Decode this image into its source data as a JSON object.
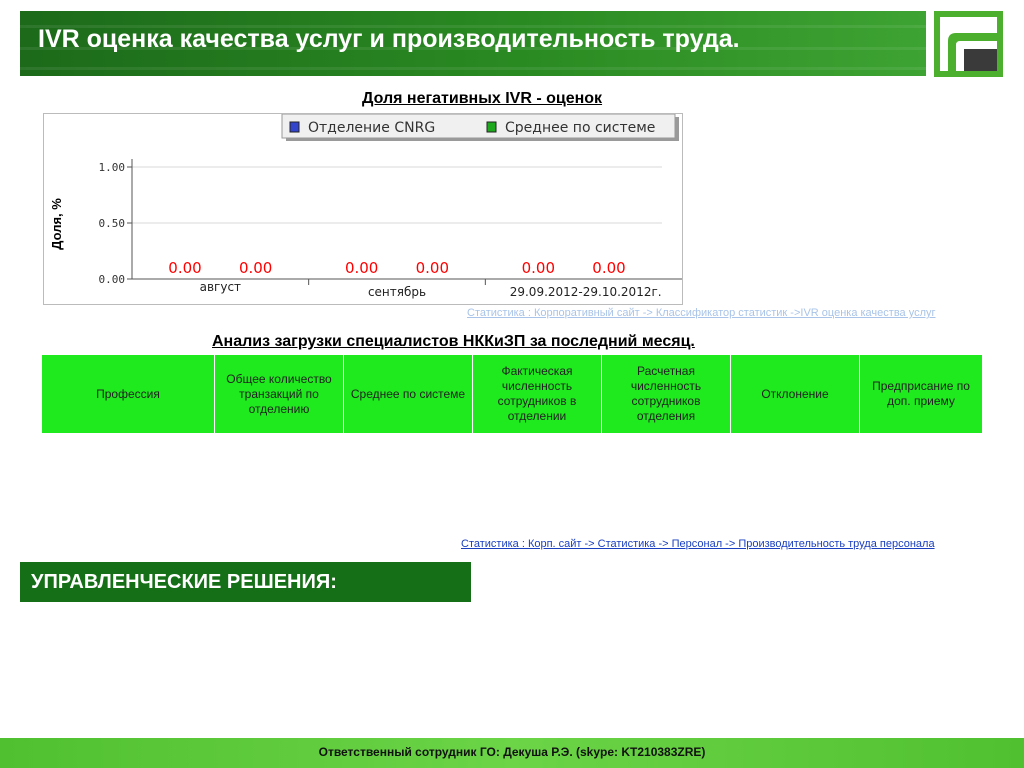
{
  "header": {
    "title": "IVR оценка качества услуг и производительность труда."
  },
  "chart_section": {
    "title": "Доля негативных IVR - оценок"
  },
  "chart_data": {
    "type": "bar",
    "ylabel": "Доля, %",
    "ylim": [
      0,
      1
    ],
    "y_ticks": [
      "1.00",
      "0.50",
      "0.00"
    ],
    "y_tick_values": [
      1,
      0.5,
      0
    ],
    "categories": [
      "август",
      "сентябрь",
      "29.09.2012-29.10.2012г."
    ],
    "series": [
      {
        "name": "Отделение CNRG",
        "values": [
          0,
          0,
          0
        ],
        "color": "#3344cc"
      },
      {
        "name": "Среднее по системе",
        "values": [
          0,
          0,
          0
        ],
        "color": "#1ea81e"
      }
    ],
    "data_labels": [
      [
        "0.00",
        "0.00"
      ],
      [
        "0.00",
        "0.00"
      ],
      [
        "0.00",
        "0.00"
      ]
    ],
    "label_color": "#ff0000",
    "grid": true,
    "legend_position": "top"
  },
  "chart_source_link": "Статистика : Корпоративный сайт -> Классификатор статистик ->IVR оценка качества услуг",
  "analysis_section": {
    "title": "Анализ загрузки специалистов НККиЗП за последний месяц."
  },
  "table": {
    "columns": [
      "Профессия",
      "Общее количество транзакций по отделению",
      "Среднее по системе",
      "Фактическая численность сотрудников в отделении",
      "Расчетная численность сотрудников отделения",
      "Отклонение",
      "Предприсание по доп. приему"
    ],
    "rows": []
  },
  "table_source_link": "Статистика : Корп. сайт -> Статистика -> Персонал -> Производительность труда персонала",
  "decisions": {
    "title": "УПРАВЛЕНЧЕСКИЕ РЕШЕНИЯ:"
  },
  "footer": {
    "text": "Ответственный сотрудник ГО: Декуша Р.Э. (skype: KT210383ZRE)"
  },
  "colors": {
    "header_green": "#2a8a22",
    "table_header_green": "#1eea1e",
    "decisions_green": "#156f16",
    "link_blue": "#1a3fbf"
  }
}
